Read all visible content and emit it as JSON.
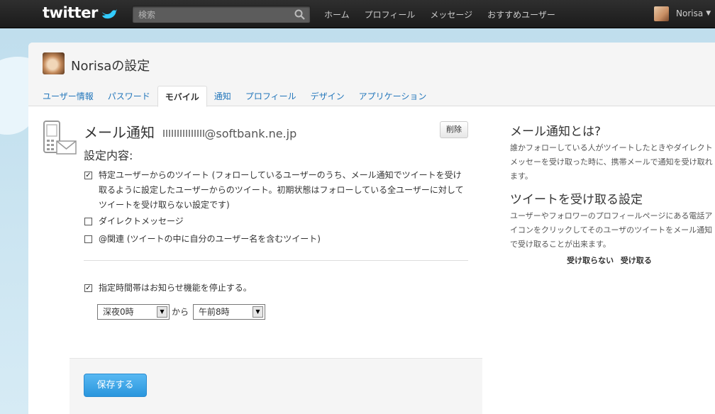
{
  "topbar": {
    "logo": "twitter",
    "search_placeholder": "検索",
    "nav": [
      "ホーム",
      "プロフィール",
      "メッセージ",
      "おすすめユーザー"
    ],
    "username": "Norisa"
  },
  "header": {
    "title": "Norisaの設定",
    "tabs": [
      "ユーザー情報",
      "パスワード",
      "モバイル",
      "通知",
      "プロフィール",
      "デザイン",
      "アプリケーション"
    ],
    "active_tab": "モバイル"
  },
  "main": {
    "section_title": "メール通知",
    "email_domain": "@softbank.ne.jp",
    "delete_label": "削除",
    "settings_label": "設定内容:",
    "options": [
      {
        "label": "特定ユーザーからのツイート (フォローしているユーザーのうち、メール通知でツイートを受け取るように設定したユーザーからのツイート。初期状態はフォローしている全ユーザーに対してツイートを受け取らない設定です)",
        "checked": true
      },
      {
        "label": "ダイレクトメッセージ",
        "checked": false
      },
      {
        "label": "@関連 (ツイートの中に自分のユーザー名を含むツイート)",
        "checked": false
      }
    ],
    "quiet_hours": {
      "label": "指定時間帯はお知らせ機能を停止する。",
      "checked": true,
      "from": "深夜0時",
      "connector": "から",
      "to": "午前8時"
    },
    "save_label": "保存する"
  },
  "sidebar": {
    "heading1": "メール通知とは?",
    "text1": "誰かフォローしている人がツイートしたときやダイレクトメッセーを受け取った時に、携帯メールで通知を受け取れます。",
    "heading2": "ツイートを受け取る設定",
    "text2": "ユーザーやフォロワーのプロフィールページにある電話アイコンをクリックしてそのユーザのツイートをメール通知で受け取ることが出来ます。",
    "link1": "受け取らない",
    "link2": "受け取る"
  },
  "colors": {
    "accent": "#2276bb",
    "button": "#2a96dd",
    "topbar": "#1f1f1f"
  }
}
